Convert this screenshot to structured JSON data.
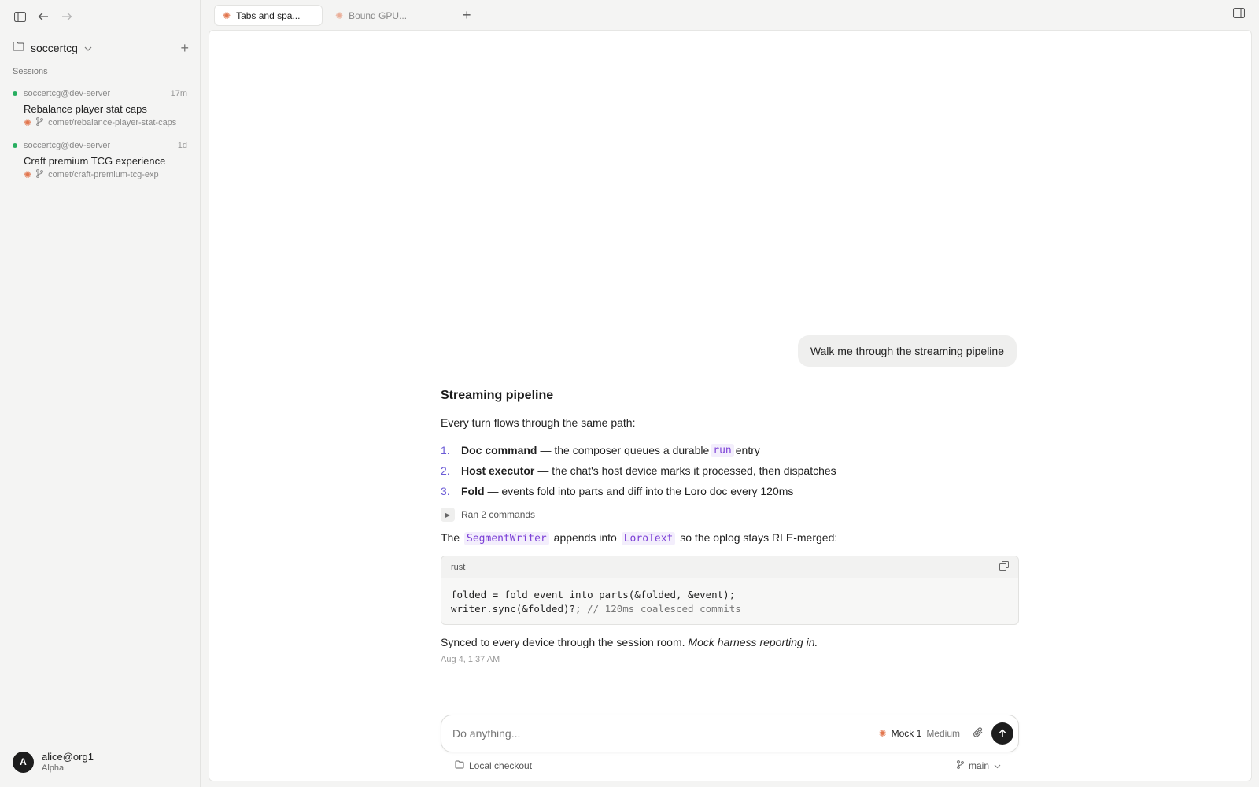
{
  "project": {
    "name": "soccertcg"
  },
  "sessions_label": "Sessions",
  "sessions": [
    {
      "host": "soccertcg@dev-server",
      "age": "17m",
      "title": "Rebalance player stat caps",
      "branch": "comet/rebalance-player-stat-caps"
    },
    {
      "host": "soccertcg@dev-server",
      "age": "1d",
      "title": "Craft premium TCG experience",
      "branch": "comet/craft-premium-tcg-exp"
    }
  ],
  "user": {
    "initial": "A",
    "name": "alice@org1",
    "org": "Alpha"
  },
  "tabs": [
    {
      "label": "Tabs and spa..."
    },
    {
      "label": "Bound GPU..."
    }
  ],
  "chat": {
    "user_message": "Walk me through the streaming pipeline",
    "heading": "Streaming pipeline",
    "intro": "Every turn flows through the same path:",
    "steps": [
      {
        "num": "1.",
        "bold": "Doc command",
        "text_a": "— the composer queues a durable",
        "code": "run",
        "text_b": "entry"
      },
      {
        "num": "2.",
        "bold": "Host executor",
        "text_a": "— the chat's host device marks it processed, then dispatches"
      },
      {
        "num": "3.",
        "bold": "Fold",
        "text_a": "— events fold into parts and diff into the Loro doc every 120ms"
      }
    ],
    "ran_commands": "Ran 2 commands",
    "segment": {
      "pre": "The",
      "code1": "SegmentWriter",
      "mid": "appends into",
      "code2": "LoroText",
      "post": "so the oplog stays RLE-merged:"
    },
    "code_block": {
      "lang": "rust",
      "line1": "folded = fold_event_into_parts(&folded, &event);",
      "line2_code": "writer.sync(&folded)?;",
      "line2_comment": "// 120ms coalesced commits"
    },
    "synced_text": "Synced to every device through the session room.",
    "synced_italic": "Mock harness reporting in.",
    "timestamp": "Aug 4, 1:37 AM"
  },
  "composer": {
    "placeholder": "Do anything...",
    "model": "Mock 1",
    "effort": "Medium"
  },
  "footer": {
    "checkout": "Local checkout",
    "branch": "main"
  },
  "colors": {
    "accent_purple": "#6b5bd6",
    "spark_orange": "#e2764e",
    "status_green": "#27ae60"
  }
}
